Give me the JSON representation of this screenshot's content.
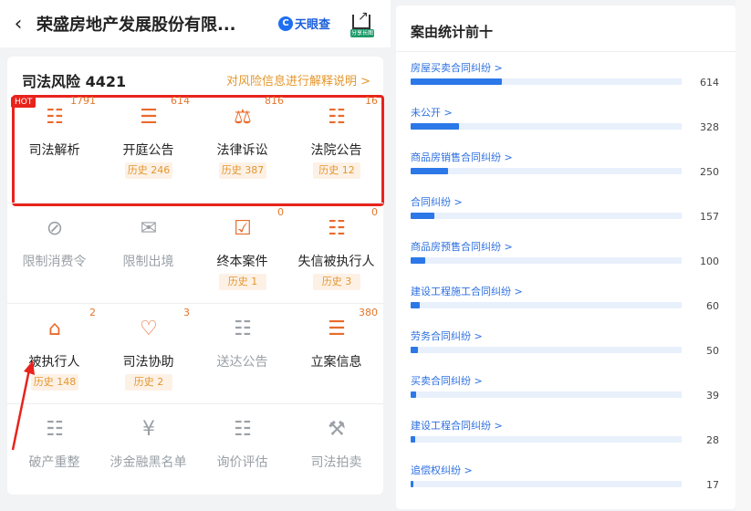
{
  "left": {
    "back_icon": "chevron-left-icon",
    "title": "荣盛房地产发展股份有限...",
    "logo_text": "天眼查",
    "share_tag": "分享长图",
    "risk_title": "司法风险",
    "risk_count": "4421",
    "risk_link": "对风险信息进行解释说明 >",
    "hot_badge": "HOT",
    "rows": [
      [
        {
          "label": "司法解析",
          "count": "1791",
          "history": "",
          "icon": "analysis-icon",
          "active": true
        },
        {
          "label": "开庭公告",
          "count": "614",
          "history": "历史 246",
          "icon": "document-icon",
          "active": true
        },
        {
          "label": "法律诉讼",
          "count": "816",
          "history": "历史 387",
          "icon": "scale-icon",
          "active": true
        },
        {
          "label": "法院公告",
          "count": "16",
          "history": "历史 12",
          "icon": "notice-icon",
          "active": true
        }
      ],
      [
        {
          "label": "限制消费令",
          "count": "",
          "history": "",
          "icon": "restrict-icon",
          "active": false
        },
        {
          "label": "限制出境",
          "count": "",
          "history": "",
          "icon": "passport-icon",
          "active": false
        },
        {
          "label": "终本案件",
          "count": "0",
          "history": "历史 1",
          "icon": "case-end-icon",
          "active": true
        },
        {
          "label": "失信被执行人",
          "count": "0",
          "history": "历史 3",
          "icon": "id-card-icon",
          "active": true
        }
      ],
      [
        {
          "label": "被执行人",
          "count": "2",
          "history": "历史 148",
          "icon": "executed-icon",
          "active": true
        },
        {
          "label": "司法协助",
          "count": "3",
          "history": "历史 2",
          "icon": "shield-icon",
          "active": true
        },
        {
          "label": "送达公告",
          "count": "",
          "history": "",
          "icon": "delivery-icon",
          "active": false
        },
        {
          "label": "立案信息",
          "count": "380",
          "history": "",
          "icon": "filing-icon",
          "active": true
        }
      ],
      [
        {
          "label": "破产重整",
          "count": "",
          "history": "",
          "icon": "bankrupt-icon",
          "active": false
        },
        {
          "label": "涉金融黑名单",
          "count": "",
          "history": "",
          "icon": "blacklist-icon",
          "active": false
        },
        {
          "label": "询价评估",
          "count": "",
          "history": "",
          "icon": "appraisal-icon",
          "active": false
        },
        {
          "label": "司法拍卖",
          "count": "",
          "history": "",
          "icon": "auction-icon",
          "active": false
        }
      ]
    ]
  },
  "right": {
    "title": "案由统计前十",
    "items": [
      {
        "name": "房屋买卖合同纠纷 >",
        "value": 614
      },
      {
        "name": "未公开 >",
        "value": 328
      },
      {
        "name": "商品房销售合同纠纷 >",
        "value": 250
      },
      {
        "name": "合同纠纷 >",
        "value": 157
      },
      {
        "name": "商品房预售合同纠纷 >",
        "value": 100
      },
      {
        "name": "建设工程施工合同纠纷 >",
        "value": 60
      },
      {
        "name": "劳务合同纠纷 >",
        "value": 50
      },
      {
        "name": "买卖合同纠纷 >",
        "value": 39
      },
      {
        "name": "建设工程合同纠纷 >",
        "value": 28
      },
      {
        "name": "追偿权纠纷 >",
        "value": 17
      }
    ]
  },
  "colors": {
    "accent": "#2c78e8",
    "warn": "#e3962b",
    "red": "#e8231c",
    "hot": "#e86b2b"
  }
}
